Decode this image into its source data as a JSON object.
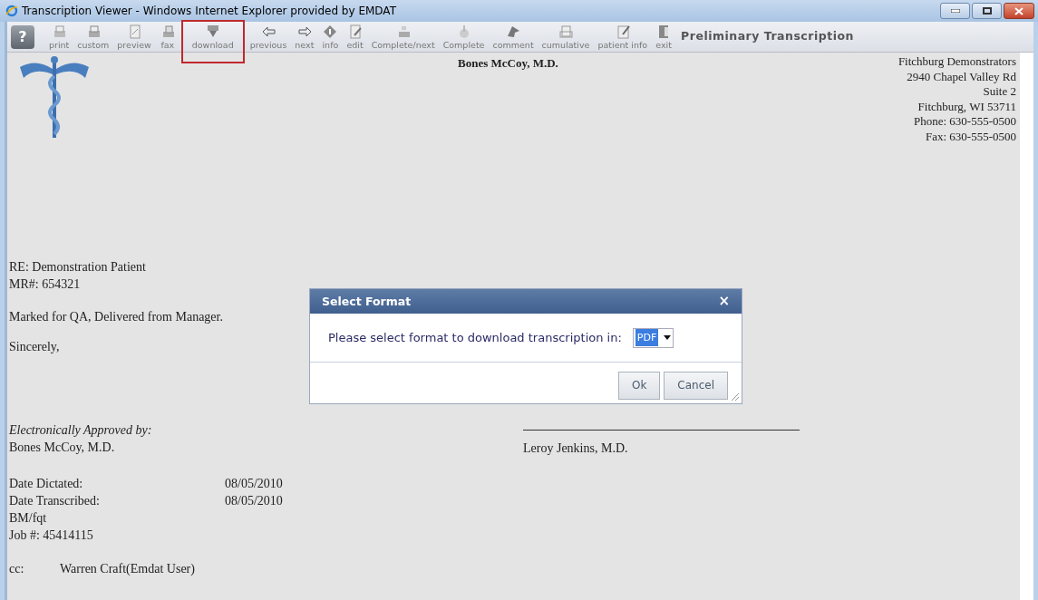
{
  "window": {
    "title": "Transcription Viewer - Windows Internet Explorer provided by EMDAT"
  },
  "toolbar": {
    "help": "?",
    "items": [
      {
        "label": "print",
        "highlighted": false
      },
      {
        "label": "custom",
        "highlighted": false
      },
      {
        "label": "preview",
        "highlighted": false
      },
      {
        "label": "fax",
        "highlighted": false
      },
      {
        "label": "download",
        "highlighted": true
      },
      {
        "label": "previous",
        "highlighted": false
      },
      {
        "label": "next",
        "highlighted": false
      },
      {
        "label": "info",
        "highlighted": false
      },
      {
        "label": "edit",
        "highlighted": false
      },
      {
        "label": "Complete/next",
        "highlighted": false
      },
      {
        "label": "Complete",
        "highlighted": false
      },
      {
        "label": "comment",
        "highlighted": false
      },
      {
        "label": "cumulative",
        "highlighted": false
      },
      {
        "label": "patient info",
        "highlighted": false
      },
      {
        "label": "exit",
        "highlighted": false
      }
    ],
    "status": "Preliminary Transcription"
  },
  "document": {
    "doctor": "Bones McCoy, M.D.",
    "address": [
      "Fitchburg Demonstrators",
      "2940 Chapel Valley Rd",
      "Suite 2",
      "Fitchburg, WI 53711",
      "Phone: 630-555-0500",
      "Fax: 630-555-0500"
    ],
    "re": "RE: Demonstration Patient",
    "mr": "MR#: 654321",
    "body": "Marked for QA, Delivered from Manager.",
    "closing": "Sincerely,",
    "approved_label": "Electronically Approved by:",
    "approver": "Bones McCoy, M.D.",
    "cosigner": "Leroy Jenkins, M.D.",
    "dates": [
      {
        "label": "Date Dictated:",
        "value": "08/05/2010"
      },
      {
        "label": "Date Transcribed:",
        "value": "08/05/2010"
      }
    ],
    "initials": "BM/fqt",
    "job": "Job #: 45414115",
    "cc_label": "cc:",
    "cc": "Warren Craft(Emdat User)"
  },
  "dialog": {
    "title": "Select Format",
    "close": "×",
    "prompt": "Please select format to download transcription in:",
    "format": "PDF",
    "buttons": [
      "Ok",
      "Cancel"
    ]
  }
}
